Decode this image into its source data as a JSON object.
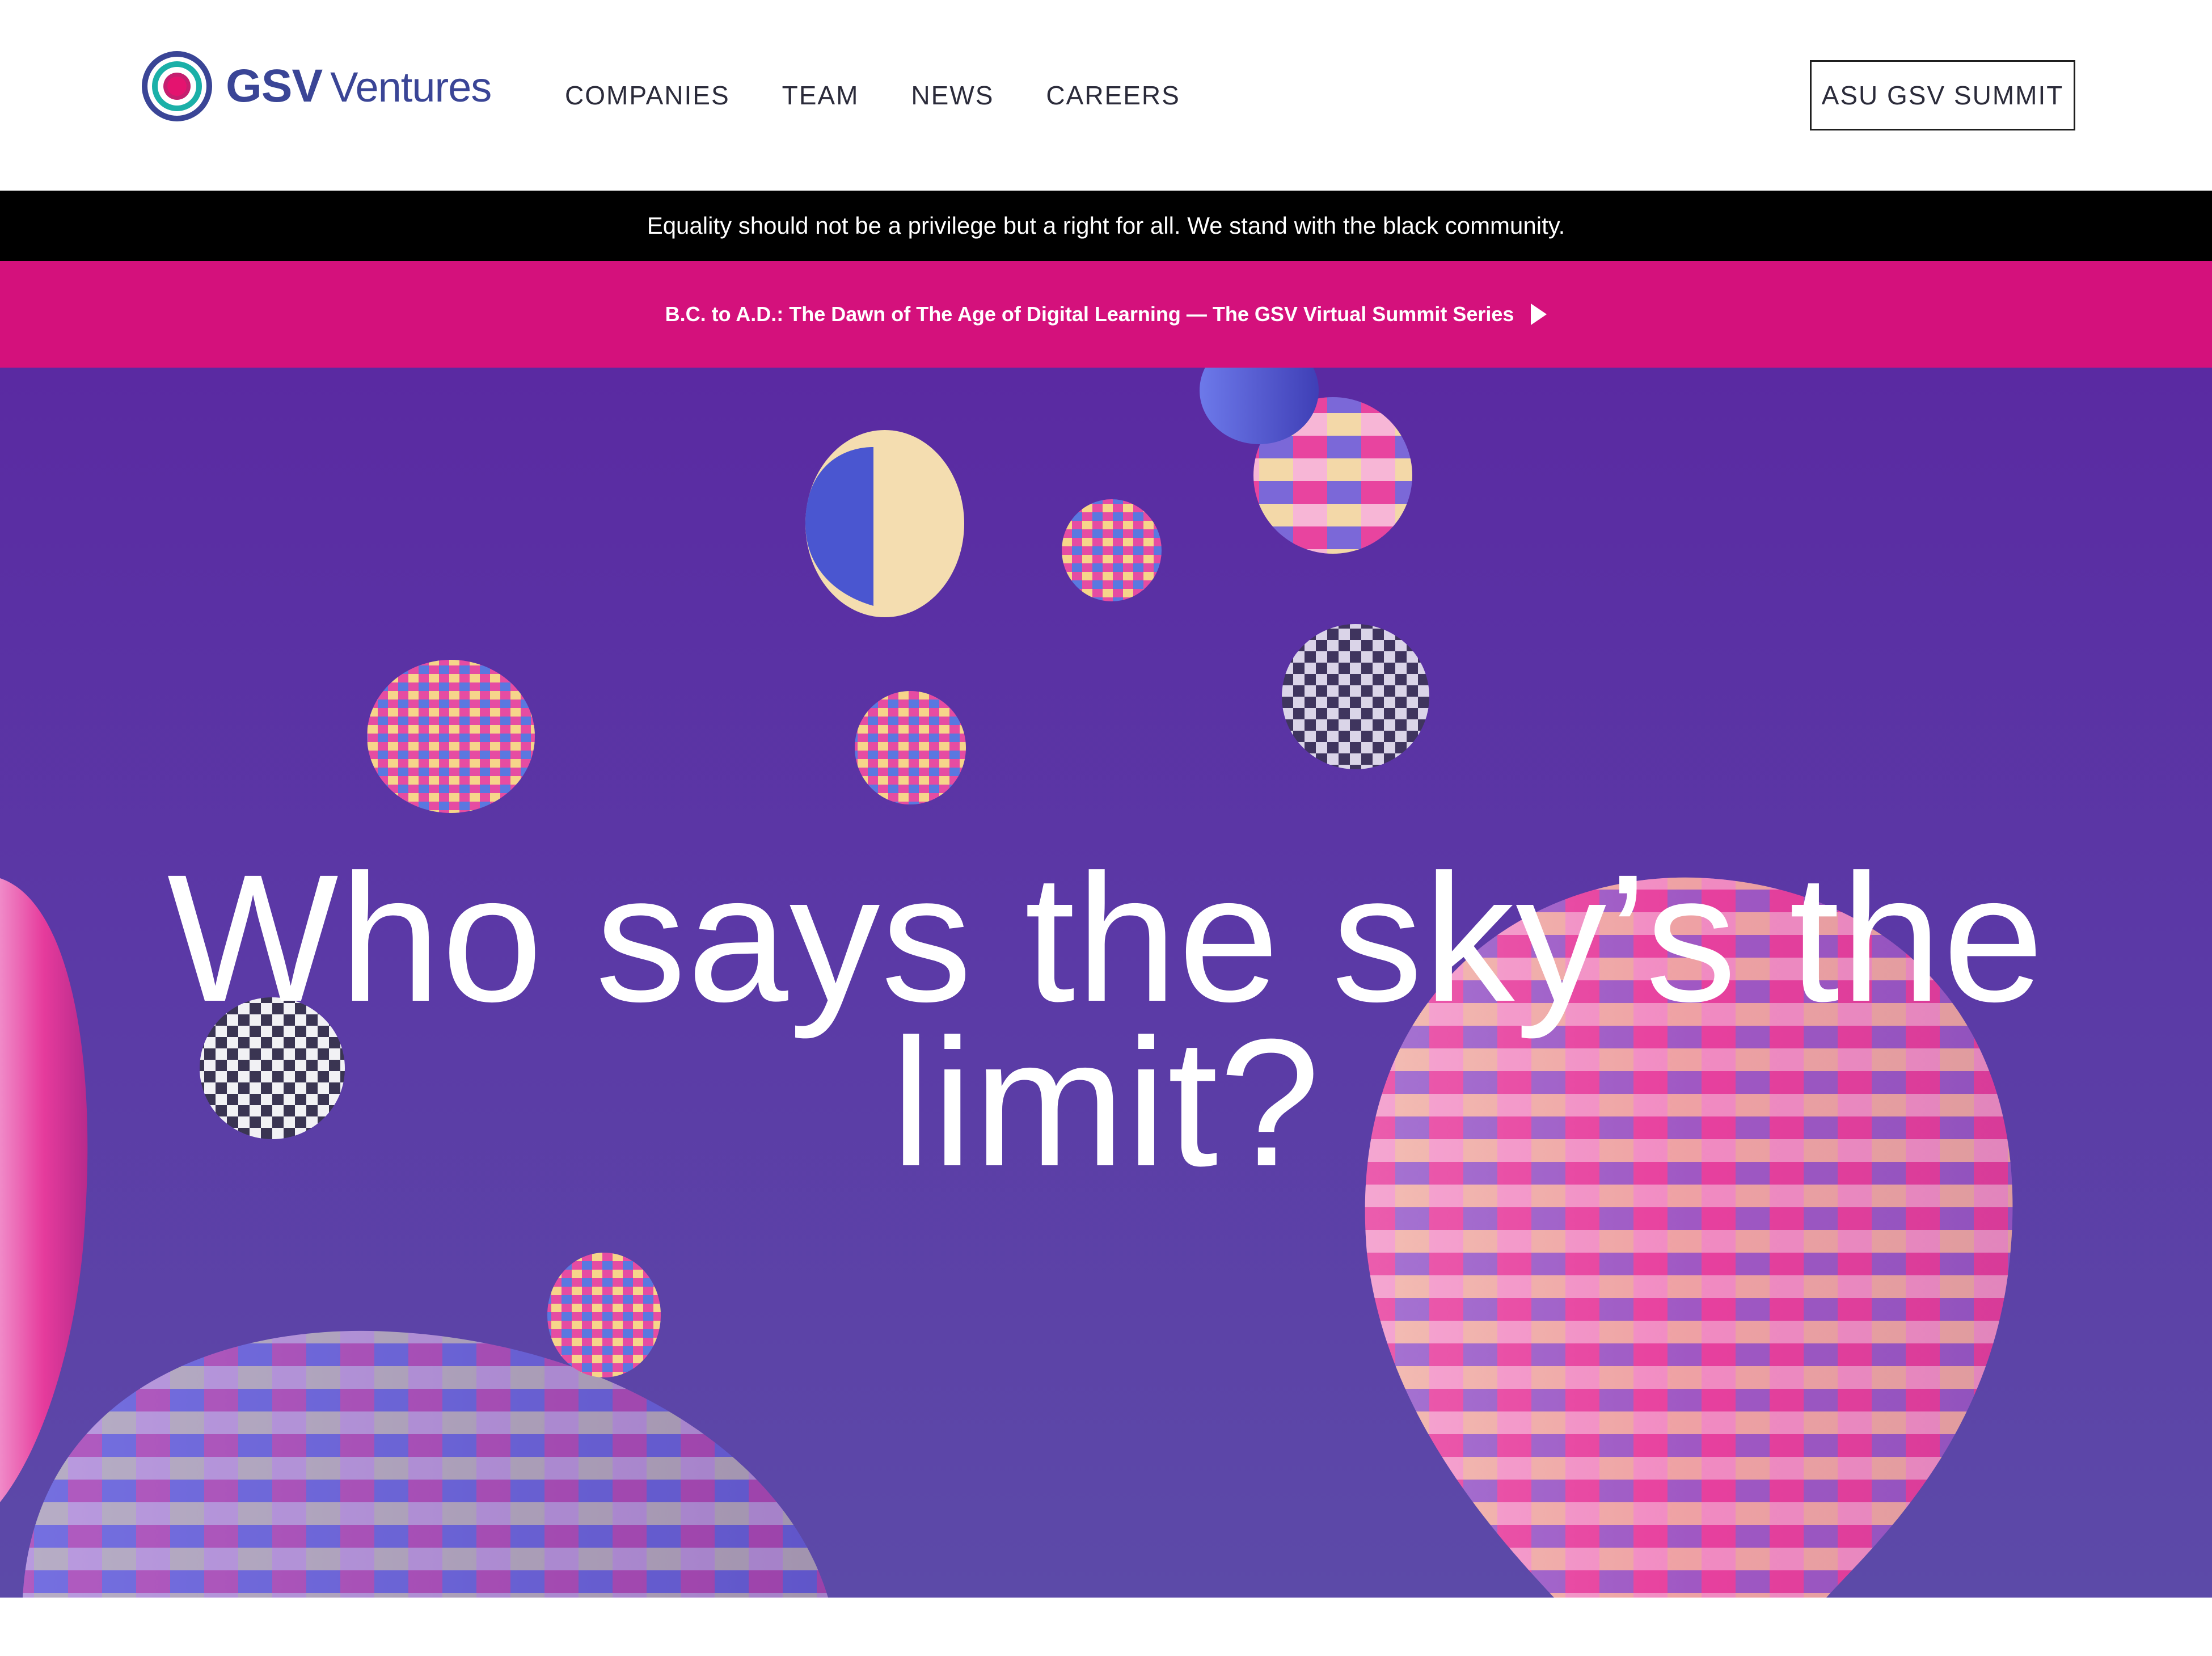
{
  "header": {
    "logo": {
      "bold": "GSV",
      "regular": "Ventures"
    },
    "nav": [
      "COMPANIES",
      "TEAM",
      "NEWS",
      "CAREERS"
    ],
    "cta_label": "ASU GSV SUMMIT"
  },
  "black_banner": {
    "text": "Equality should not be a privilege but a right for all. We stand with the black community."
  },
  "pink_banner": {
    "text": "B.C. to A.D.: The Dawn of The Age of Digital Learning — The GSV Virtual Summit Series"
  },
  "hero": {
    "headline_line1": "Who says the sky’s the",
    "headline_line2": "limit?"
  },
  "colors": {
    "brand_navy": "#3a4596",
    "brand_pink": "#d4117c",
    "brand_teal": "#1bb0a8",
    "hero_purple": "#5a2aa2"
  },
  "icons": [
    "gsv-logo-icon",
    "play-icon"
  ]
}
